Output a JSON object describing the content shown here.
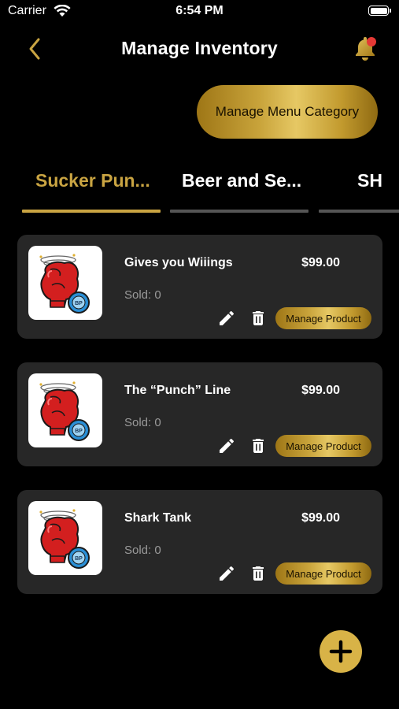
{
  "status_bar": {
    "carrier": "Carrier",
    "time": "6:54 PM"
  },
  "header": {
    "title": "Manage Inventory"
  },
  "manage_menu_category_label": "Manage Menu Category",
  "tabs": [
    {
      "label": "Sucker Pun...",
      "active": true
    },
    {
      "label": "Beer and Se...",
      "active": false
    },
    {
      "label": "SH",
      "active": false
    }
  ],
  "products": [
    {
      "name": "Gives you Wiiings",
      "price": "$99.00",
      "sold": "Sold: 0",
      "manage_label": "Manage Product"
    },
    {
      "name": "The “Punch” Line",
      "price": "$99.00",
      "sold": "Sold: 0",
      "manage_label": "Manage Product"
    },
    {
      "name": "Shark Tank",
      "price": "$99.00",
      "sold": "Sold: 0",
      "manage_label": "Manage Product"
    }
  ],
  "product_thumb_label": "BP",
  "colors": {
    "gold": "#c9a442",
    "card_bg": "#272727",
    "notification_dot": "#e53935",
    "fab": "#d8b347"
  },
  "icons": [
    "back-chevron-icon",
    "bell-icon",
    "edit-pencil-icon",
    "trash-icon",
    "plus-icon",
    "wifi-icon",
    "battery-icon"
  ]
}
